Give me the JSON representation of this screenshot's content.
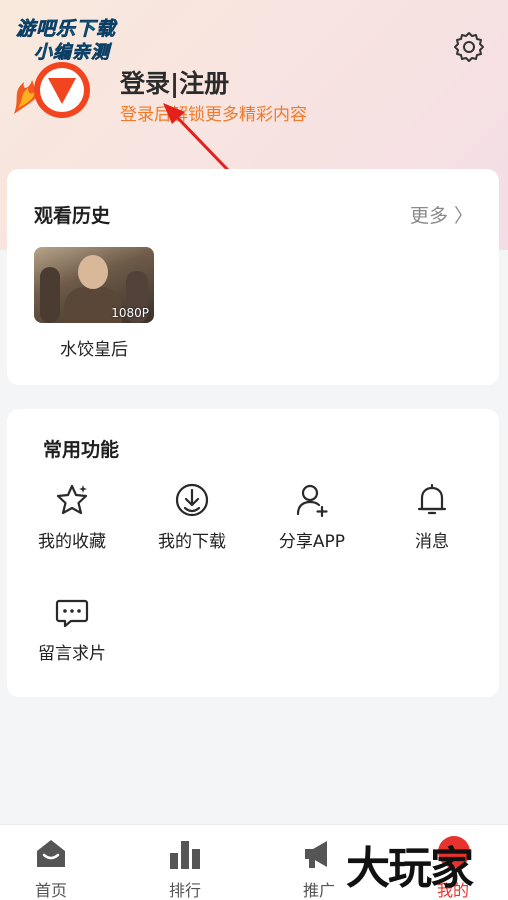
{
  "watermark_top": {
    "line1": "游吧乐下载",
    "line2": "小编亲测"
  },
  "profile": {
    "title": "登录|注册",
    "subtitle": "登录后解锁更多精彩内容"
  },
  "history": {
    "title": "观看历史",
    "more": "更多 〉",
    "items": [
      {
        "title": "水饺皇后",
        "quality": "1080P"
      }
    ]
  },
  "functions": {
    "title": "常用功能",
    "items": [
      {
        "label": "我的收藏",
        "icon": "star-icon"
      },
      {
        "label": "我的下载",
        "icon": "download-icon"
      },
      {
        "label": "分享APP",
        "icon": "user-add-icon"
      },
      {
        "label": "消息",
        "icon": "bell-icon"
      },
      {
        "label": "留言求片",
        "icon": "chat-icon"
      }
    ]
  },
  "tabbar": {
    "items": [
      {
        "label": "首页",
        "icon": "home-icon"
      },
      {
        "label": "排行",
        "icon": "ranking-icon"
      },
      {
        "label": "推广",
        "icon": "megaphone-icon"
      },
      {
        "label": "我的",
        "icon": "profile-icon"
      }
    ],
    "active": "我的"
  },
  "watermark_bottom": "大玩家",
  "colors": {
    "accent": "#e8322e",
    "subtitle_orange": "#f07a2a",
    "header_bg": "#f7e2e2",
    "page_bg": "#f4f5f7"
  }
}
